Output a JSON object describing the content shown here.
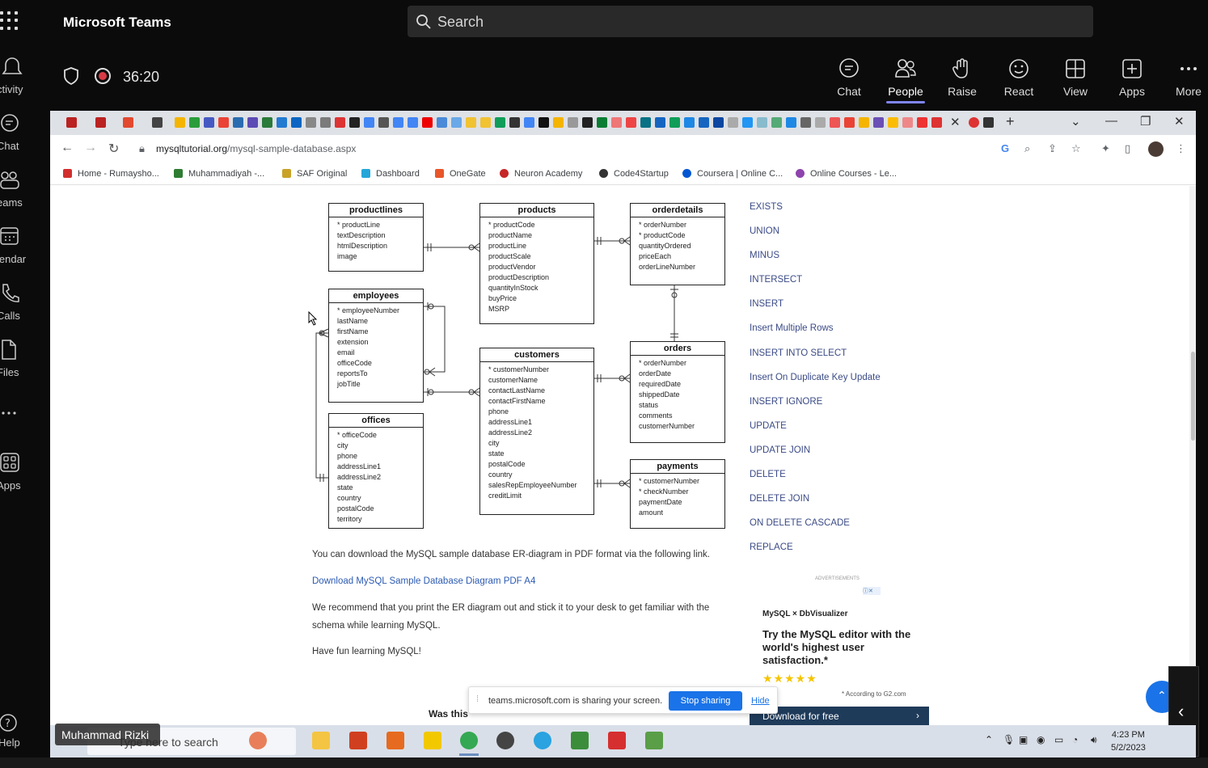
{
  "teams": {
    "app_title": "Microsoft Teams",
    "search_placeholder": "Search",
    "rail": [
      {
        "label": "ctivity",
        "icon": "bell-icon"
      },
      {
        "label": "Chat",
        "icon": "chat-icon"
      },
      {
        "label": "eams",
        "icon": "teams-icon"
      },
      {
        "label": "lendar",
        "icon": "calendar-icon"
      },
      {
        "label": "Calls",
        "icon": "phone-icon"
      },
      {
        "label": "Files",
        "icon": "file-icon"
      },
      {
        "label": "",
        "icon": "more-dots-icon"
      },
      {
        "label": "Apps",
        "icon": "apps-icon"
      }
    ],
    "help_label": "Help",
    "timer": "36:20",
    "meeting_buttons": [
      {
        "label": "Chat",
        "icon": "chat-bubble-icon"
      },
      {
        "label": "People",
        "icon": "people-icon",
        "active": true
      },
      {
        "label": "Raise",
        "icon": "hand-icon"
      },
      {
        "label": "React",
        "icon": "smiley-icon"
      },
      {
        "label": "View",
        "icon": "grid-view-icon"
      },
      {
        "label": "Apps",
        "icon": "add-app-icon"
      },
      {
        "label": "More",
        "icon": "ellipsis-icon"
      }
    ],
    "presenter_name": "Muhammad Rizki"
  },
  "browser": {
    "url_domain": "mysqltutorial.org",
    "url_path": "/mysql-sample-database.aspx",
    "bookmarks": [
      {
        "label": "Home - Rumaysho...",
        "color": "#d32f2f"
      },
      {
        "label": "Muhammadiyah -...",
        "color": "#2e7d32"
      },
      {
        "label": "SAF Original",
        "color": "#c9a227"
      },
      {
        "label": "Dashboard",
        "color": "#26a6d8"
      },
      {
        "label": "OneGate",
        "color": "#e8562a"
      },
      {
        "label": "Neuron Academy",
        "color": "#c62828"
      },
      {
        "label": "Code4Startup",
        "color": "#333333"
      },
      {
        "label": "Coursera | Online C...",
        "color": "#0056d2"
      },
      {
        "label": "Online Courses - Le...",
        "color": "#8e44ad"
      }
    ]
  },
  "diagram": {
    "entities": [
      {
        "id": "productlines",
        "title": "productlines",
        "fields": [
          "* productLine",
          "textDescription",
          "htmlDescription",
          "image"
        ]
      },
      {
        "id": "products",
        "title": "products",
        "fields": [
          "* productCode",
          "productName",
          "productLine",
          "productScale",
          "productVendor",
          "productDescription",
          "quantityInStock",
          "buyPrice",
          "MSRP"
        ]
      },
      {
        "id": "orderdetails",
        "title": "orderdetails",
        "fields": [
          "* orderNumber",
          "* productCode",
          "quantityOrdered",
          "priceEach",
          "orderLineNumber"
        ]
      },
      {
        "id": "employees",
        "title": "employees",
        "fields": [
          "* employeeNumber",
          "lastName",
          "firstName",
          "extension",
          "email",
          "officeCode",
          "reportsTo",
          "jobTitle"
        ]
      },
      {
        "id": "customers",
        "title": "customers",
        "fields": [
          "* customerNumber",
          "customerName",
          "contactLastName",
          "contactFirstName",
          "phone",
          "addressLine1",
          "addressLine2",
          "city",
          "state",
          "postalCode",
          "country",
          "salesRepEmployeeNumber",
          "creditLimit"
        ]
      },
      {
        "id": "orders",
        "title": "orders",
        "fields": [
          "* orderNumber",
          "orderDate",
          "requiredDate",
          "shippedDate",
          "status",
          "comments",
          "customerNumber"
        ]
      },
      {
        "id": "offices",
        "title": "offices",
        "fields": [
          "* officeCode",
          "city",
          "phone",
          "addressLine1",
          "addressLine2",
          "state",
          "country",
          "postalCode",
          "territory"
        ]
      },
      {
        "id": "payments",
        "title": "payments",
        "fields": [
          "* customerNumber",
          "* checkNumber",
          "paymentDate",
          "amount"
        ]
      }
    ]
  },
  "sidebar_links": [
    "EXISTS",
    "UNION",
    "MINUS",
    "INTERSECT",
    "INSERT",
    "Insert Multiple Rows",
    "INSERT INTO SELECT",
    "Insert On Duplicate Key Update",
    "INSERT IGNORE",
    "UPDATE",
    "UPDATE JOIN",
    "DELETE",
    "DELETE JOIN",
    "ON DELETE CASCADE",
    "REPLACE"
  ],
  "article": {
    "p1": "You can download the MySQL sample database ER-diagram in PDF format via the following link.",
    "download_link": "Download MySQL Sample Database Diagram PDF A4",
    "p2a": "We recommend that you print the ER diagram out and stick it to your desk to get familiar with the",
    "p2b": "schema while learning MySQL.",
    "p3": "Have fun learning MySQL!",
    "was_this": "Was this"
  },
  "ad": {
    "label": "ADVERTISEMENTS",
    "logos": "MySQL  ×  DbVisualizer",
    "headline": "Try the MySQL editor with the world's highest user satisfaction.*",
    "stars": "★★★★★",
    "note": "* According to G2.com",
    "cta": "Download for free"
  },
  "share_notice": {
    "text": "teams.microsoft.com is sharing your screen.",
    "stop": "Stop sharing",
    "hide": "Hide"
  },
  "taskbar": {
    "search_placeholder": "Type here to search",
    "time": "4:23 PM",
    "date": "5/2/2023"
  },
  "colors": {
    "record": "#d93b45",
    "accent": "#7f85f5",
    "stop_button": "#1a73e8"
  }
}
